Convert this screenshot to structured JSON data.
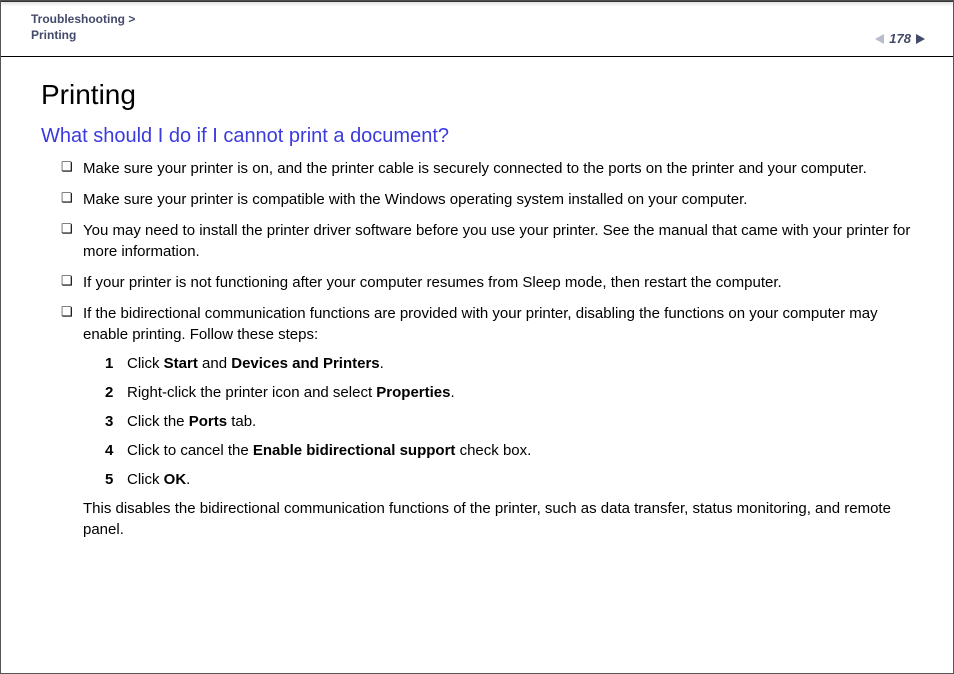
{
  "header": {
    "breadcrumb_top": "Troubleshooting >",
    "breadcrumb_sub": "Printing",
    "page_number": "178"
  },
  "title": "Printing",
  "subtitle": "What should I do if I cannot print a document?",
  "bullets": [
    "Make sure your printer is on, and the printer cable is securely connected to the ports on the printer and your computer.",
    "Make sure your printer is compatible with the Windows operating system installed on your computer.",
    "You may need to install the printer driver software before you use your printer. See the manual that came with your printer for more information.",
    "If your printer is not functioning after your computer resumes from Sleep mode, then restart the computer."
  ],
  "bullet5_intro": "If the bidirectional communication functions are provided with your printer, disabling the functions on your computer may enable printing. Follow these steps:",
  "steps": [
    {
      "n": "1",
      "pre": "Click ",
      "b1": "Start",
      "mid": " and ",
      "b2": "Devices and Printers",
      "post": "."
    },
    {
      "n": "2",
      "pre": "Right-click the printer icon and select ",
      "b1": "Properties",
      "mid": "",
      "b2": "",
      "post": "."
    },
    {
      "n": "3",
      "pre": "Click the ",
      "b1": "Ports",
      "mid": "",
      "b2": "",
      "post": " tab."
    },
    {
      "n": "4",
      "pre": "Click to cancel the ",
      "b1": "Enable bidirectional support",
      "mid": "",
      "b2": "",
      "post": " check box."
    },
    {
      "n": "5",
      "pre": "Click ",
      "b1": "OK",
      "mid": "",
      "b2": "",
      "post": "."
    }
  ],
  "after_steps": "This disables the bidirectional communication functions of the printer, such as data transfer, status monitoring, and remote panel."
}
